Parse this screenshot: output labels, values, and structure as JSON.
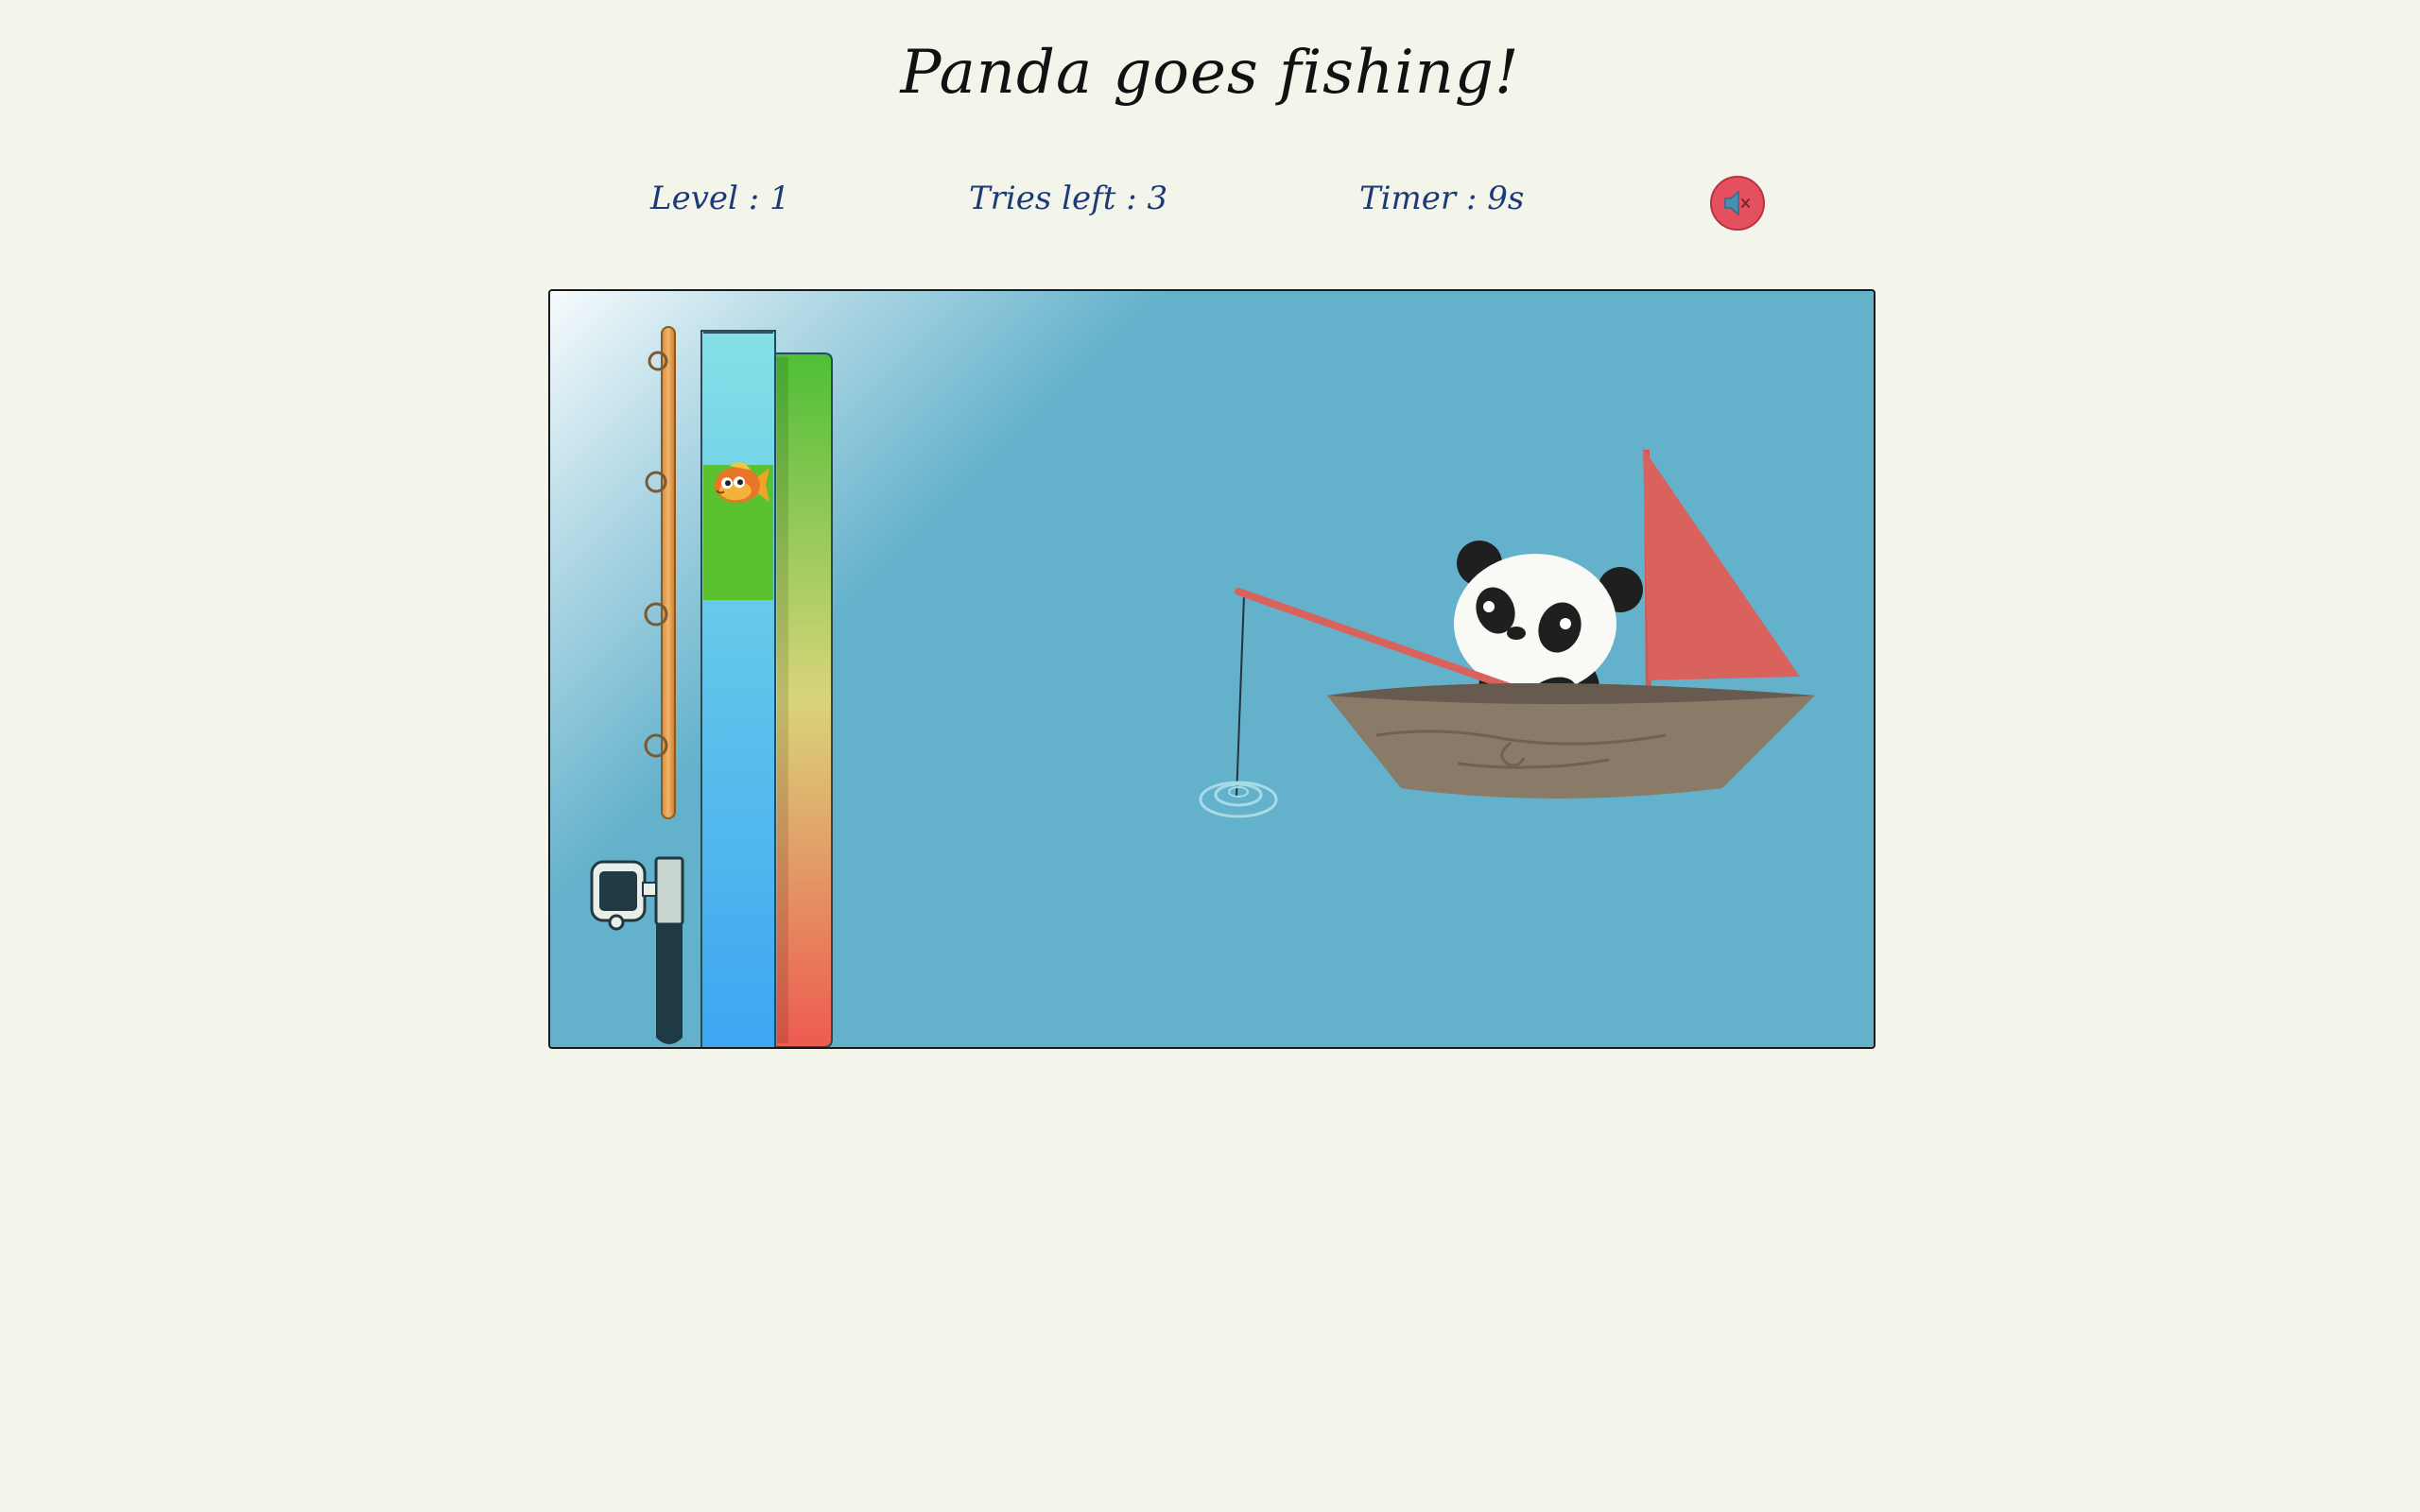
{
  "title": "Panda goes fishing!",
  "stats": {
    "level": "Level : 1",
    "tries": "Tries left : 3",
    "timer": "Timer : 9s"
  },
  "sound": {
    "muted": true,
    "icon": "speaker-muted-icon"
  },
  "meter": {
    "catch_zone_top": 0.187,
    "catch_zone_bottom": 0.375,
    "fish_position": 0.195
  },
  "colors": {
    "background": "#f3f5ea",
    "water": "#63b1cb",
    "text": "#1d3a78",
    "mute_button": "#e4505e",
    "catch_zone": "#5ac22e",
    "sail": "#d9625d"
  }
}
